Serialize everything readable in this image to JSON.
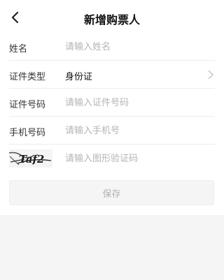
{
  "header": {
    "title": "新增购票人",
    "back_icon": "chevron-left-icon"
  },
  "form": {
    "name": {
      "label": "姓名",
      "placeholder": "请输入姓名"
    },
    "id_type": {
      "label": "证件类型",
      "value": "身份证",
      "icon": "chevron-right-icon"
    },
    "id_number": {
      "label": "证件号码",
      "placeholder": "请输入证件号码"
    },
    "phone": {
      "label": "手机号码",
      "placeholder": "请输入手机号"
    },
    "captcha": {
      "text": "Taf2",
      "placeholder": "请输入图形验证码"
    }
  },
  "save_button": {
    "label": "保存"
  },
  "colors": {
    "background": "#f5f5f5",
    "surface": "#ffffff",
    "placeholder": "#b4b4b4",
    "divider": "#ececec",
    "disabled_text": "#b0b0b0"
  }
}
